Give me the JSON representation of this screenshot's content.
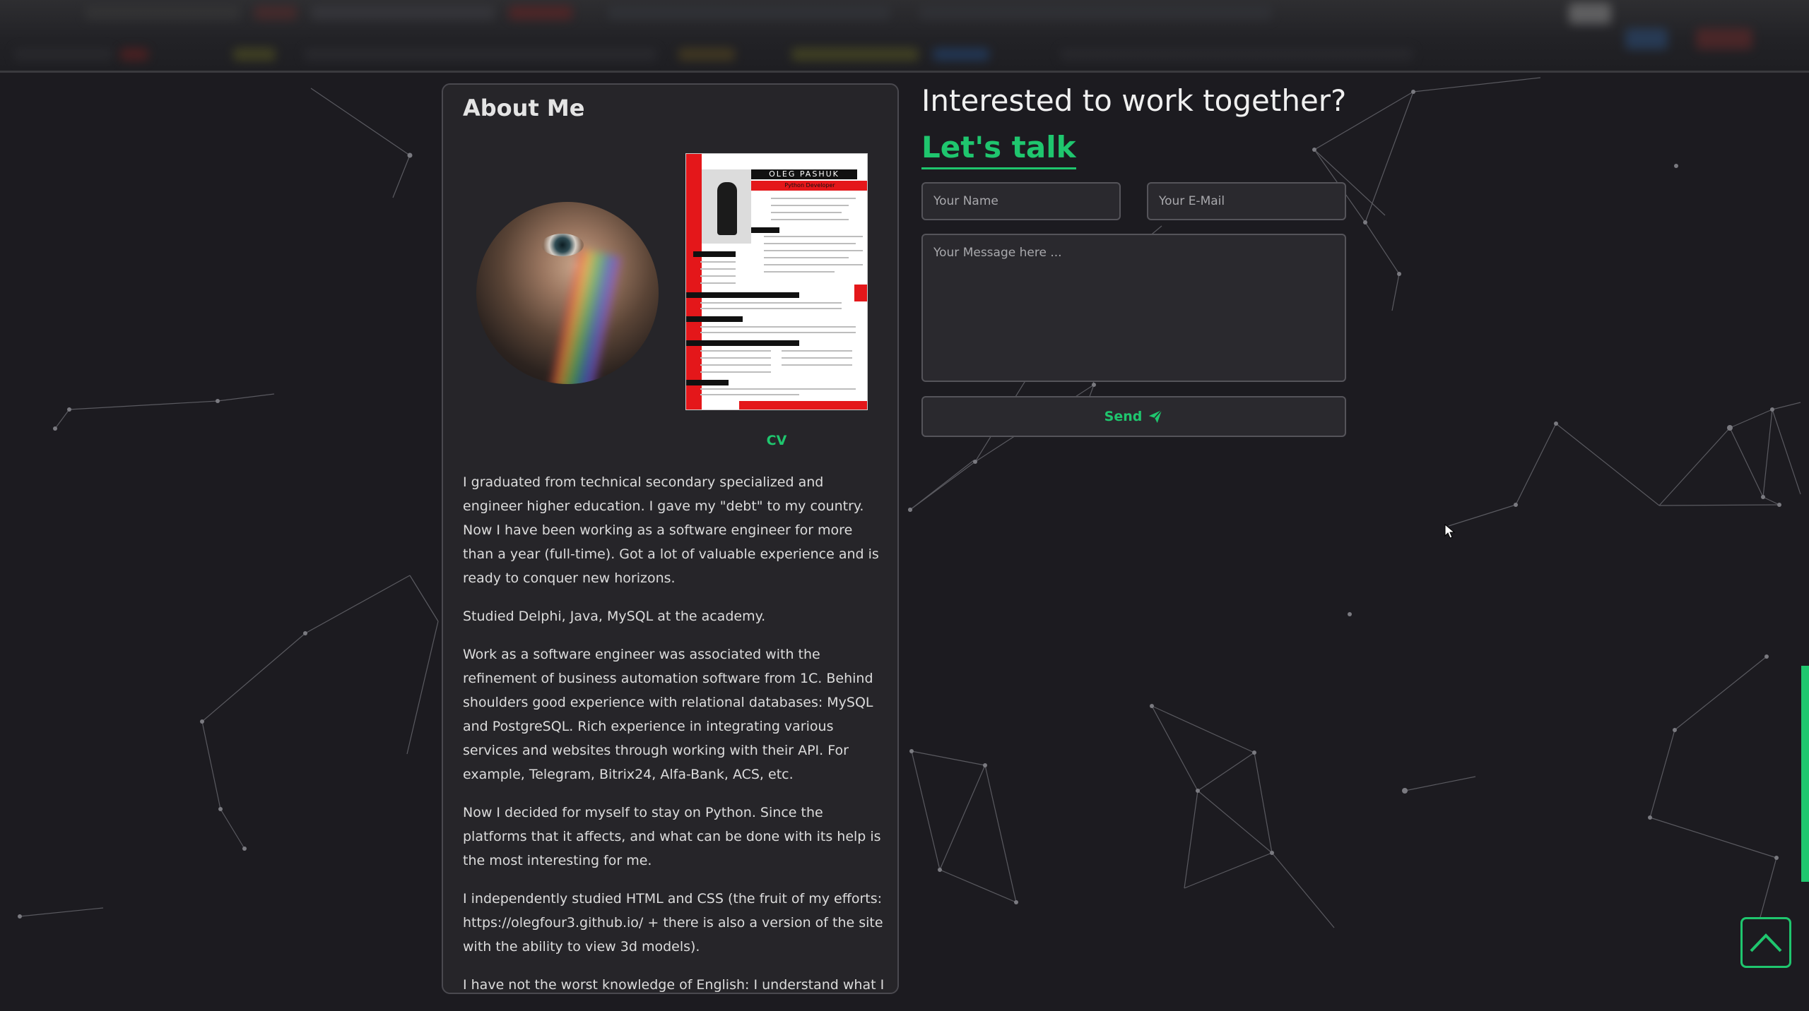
{
  "about": {
    "title": "About Me",
    "cv_label": "CV",
    "cv_name": "OLEG PASHUK",
    "cv_role": "Python Developer",
    "paragraphs": [
      "I graduated from technical secondary specialized and engineer higher education. I gave my \"debt\" to my country. Now I have been working as a software engineer for more than a year (full-time). Got a lot of valuable experience and is ready to conquer new horizons.",
      "Studied Delphi, Java, MySQL at the academy.",
      "Work as a software engineer was associated with the refinement of business automation software from 1C. Behind shoulders good experience with relational databases: MySQL and PostgreSQL. Rich experience in integrating various services and websites through working with their API. For example, Telegram, Bitrix24, Alfa-Bank, ACS, etc.",
      "Now I decided for myself to stay on Python. Since the platforms that it affects, and what can be done with its help is the most interesting for me.",
      "I independently studied HTML and CSS (the fruit of my efforts: https://olegfour3.github.io/ + there is also a version of the site with the ability to view 3d models).",
      "I have not the worst knowledge of English: I understand what I"
    ]
  },
  "contact": {
    "title": "Interested to work together?",
    "subtitle": "Let's talk",
    "name_placeholder": "Your Name",
    "email_placeholder": "Your E-Mail",
    "message_placeholder": "Your Message here ...",
    "send_label": "Send"
  },
  "colors": {
    "accent": "#1fc66e",
    "background": "#1c1b20",
    "card": "#262529"
  },
  "icons": {
    "send": "paper-plane-icon",
    "to_top": "chevron-up-icon",
    "cursor": "mouse-cursor-icon"
  }
}
